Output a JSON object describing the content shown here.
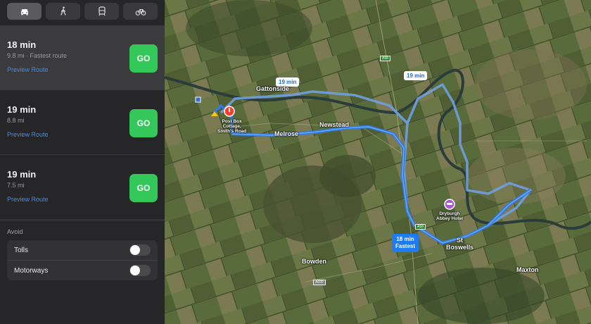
{
  "modes": [
    {
      "name": "car",
      "icon": "car-icon",
      "active": true
    },
    {
      "name": "walk",
      "icon": "walking-icon",
      "active": false
    },
    {
      "name": "transit",
      "icon": "train-icon",
      "active": false
    },
    {
      "name": "cycle",
      "icon": "bicycle-icon",
      "active": false
    }
  ],
  "routes": [
    {
      "time": "18 min",
      "subtitle": "9.8 mi · Fastest route",
      "preview": "Preview Route",
      "go": "GO"
    },
    {
      "time": "19 min",
      "subtitle": "8.8 mi",
      "preview": "Preview Route",
      "go": "GO"
    },
    {
      "time": "19 min",
      "subtitle": "7.5 mi",
      "preview": "Preview Route",
      "go": "GO"
    }
  ],
  "avoid": {
    "title": "Avoid",
    "options": [
      {
        "label": "Tolls",
        "enabled": false
      },
      {
        "label": "Motorways",
        "enabled": false
      }
    ]
  },
  "map": {
    "places": {
      "gattonside": "Gattonside",
      "melrose": "Melrose",
      "newstead": "Newstead",
      "st_boswells": "St\nBoswells",
      "bowden": "Bowden",
      "maxton": "Maxton"
    },
    "origin_pin": "Post Box\nCottage,\nSmith's Road",
    "destination_pin": "Dryburgh\nAbbey Hotel",
    "bubbles": {
      "gattonside": "19 min",
      "east": "19 min",
      "fastest_time": "18 min",
      "fastest_label": "Fastest"
    },
    "road_badges": [
      "A68",
      "A68",
      "A699"
    ],
    "route_color": "#4a8fe7",
    "alt_route_color": "#6fa0e0"
  }
}
